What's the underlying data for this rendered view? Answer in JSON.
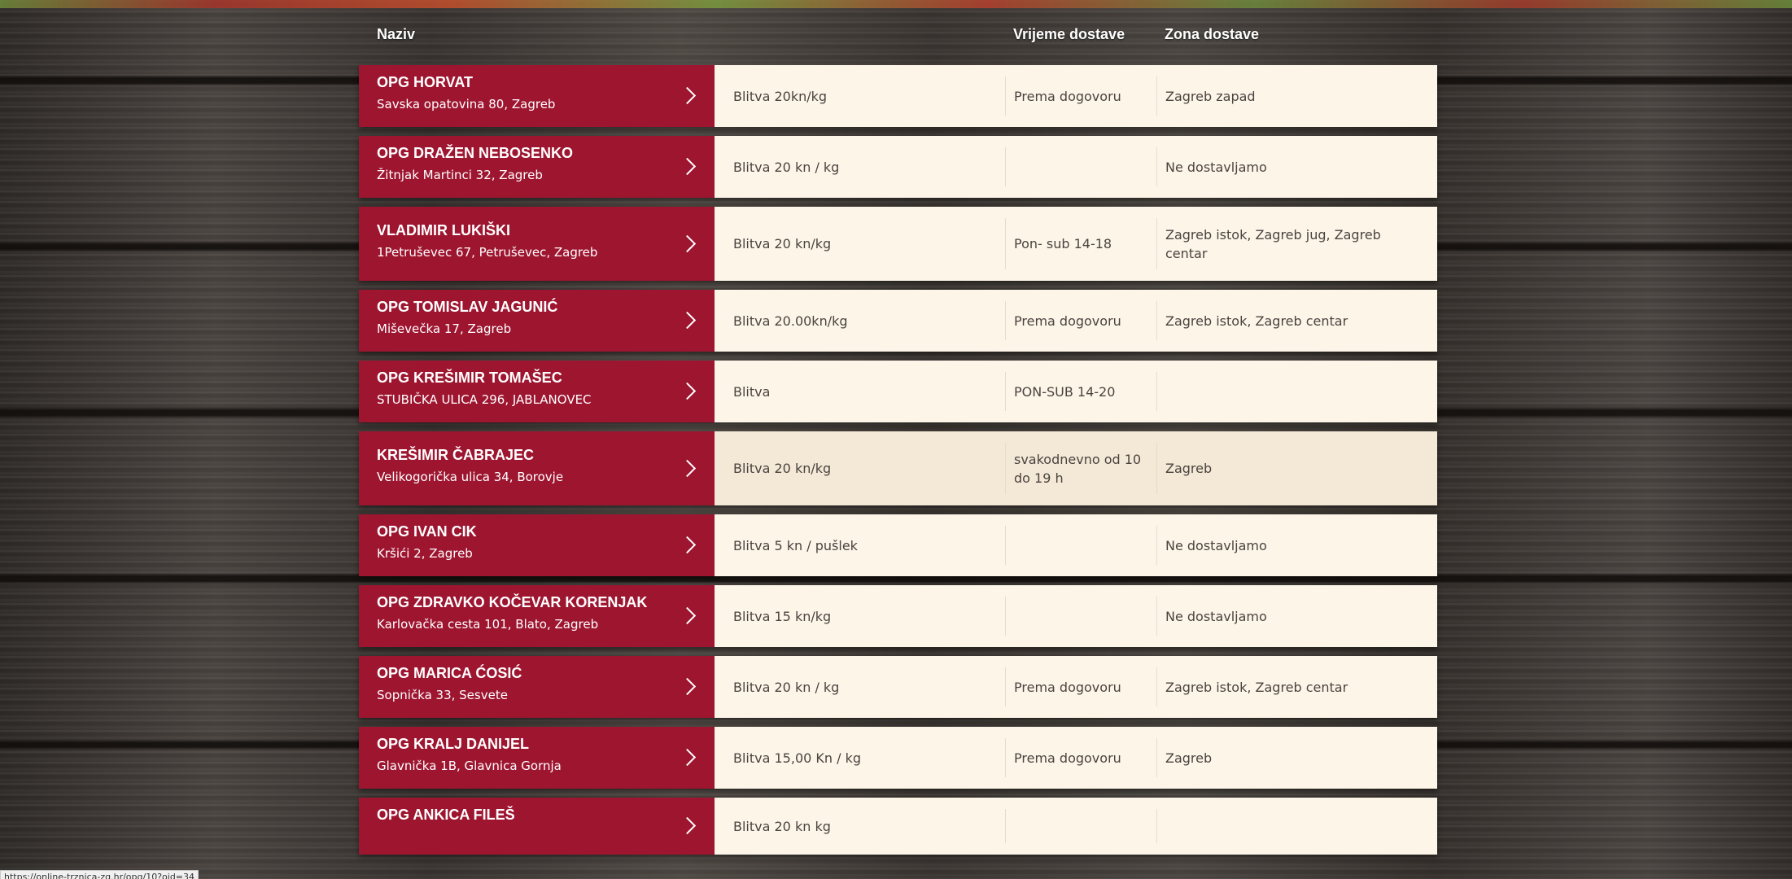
{
  "header": {
    "name": "Naziv",
    "time": "Vrijeme dostave",
    "zone": "Zona dostave"
  },
  "rows": [
    {
      "name": "OPG HORVAT",
      "address": "Savska opatovina 80, Zagreb",
      "product": "Blitva 20kn/kg",
      "time": "Prema dogovoru",
      "zone": "Zagreb zapad"
    },
    {
      "name": "OPG DRAŽEN NEBOSENKO",
      "address": "Žitnjak Martinci 32, Zagreb",
      "product": "Blitva 20 kn / kg",
      "time": "",
      "zone": "Ne dostavljamo"
    },
    {
      "name": "VLADIMIR LUKIŠKI",
      "address": "1Petruševec 67, Petruševec, Zagreb",
      "product": "Blitva 20 kn/kg",
      "time": "Pon- sub 14-18",
      "zone": "Zagreb istok, Zagreb jug, Zagreb centar"
    },
    {
      "name": "OPG TOMISLAV JAGUNIĆ",
      "address": "Miševečka 17, Zagreb",
      "product": "Blitva 20.00kn/kg",
      "time": "Prema dogovoru",
      "zone": "Zagreb istok, Zagreb centar"
    },
    {
      "name": "OPG KREŠIMIR TOMAŠEC",
      "address": "STUBIČKA ULICA 296, JABLANOVEC",
      "product": "Blitva",
      "time": "PON-SUB 14-20",
      "zone": ""
    },
    {
      "name": "KREŠIMIR ČABRAJEC",
      "address": "Velikogorička ulica 34, Borovje",
      "product": "Blitva 20 kn/kg",
      "time": "svakodnevno od 10 do 19 h",
      "zone": "Zagreb"
    },
    {
      "name": "OPG IVAN CIK",
      "address": "Kršići 2, Zagreb",
      "product": "Blitva 5 kn / pušlek",
      "time": "",
      "zone": "Ne dostavljamo"
    },
    {
      "name": "OPG ZDRAVKO KOČEVAR KORENJAK",
      "address": "Karlovačka cesta 101, Blato, Zagreb",
      "product": "Blitva 15 kn/kg",
      "time": "",
      "zone": "Ne dostavljamo"
    },
    {
      "name": "OPG MARICA ĆOSIĆ",
      "address": "Sopnička 33, Sesvete",
      "product": "Blitva 20 kn / kg",
      "time": "Prema dogovoru",
      "zone": "Zagreb istok, Zagreb centar"
    },
    {
      "name": "OPG KRALJ DANIJEL",
      "address": "Glavnička 1B, Glavnica Gornja",
      "product": "Blitva 15,00 Kn / kg",
      "time": "Prema dogovoru",
      "zone": "Zagreb"
    },
    {
      "name": "OPG ANKICA FILEŠ",
      "address": "",
      "product": "Blitva 20 kn kg",
      "time": "",
      "zone": ""
    }
  ],
  "status_bar": {
    "url": "https://online-trznica-zg.hr/opg/10?oid=34"
  },
  "colors": {
    "seller_bg": "#9e1530",
    "cell_bg": "#fdf5e8",
    "highlight_bg": "#f4e8d6"
  }
}
